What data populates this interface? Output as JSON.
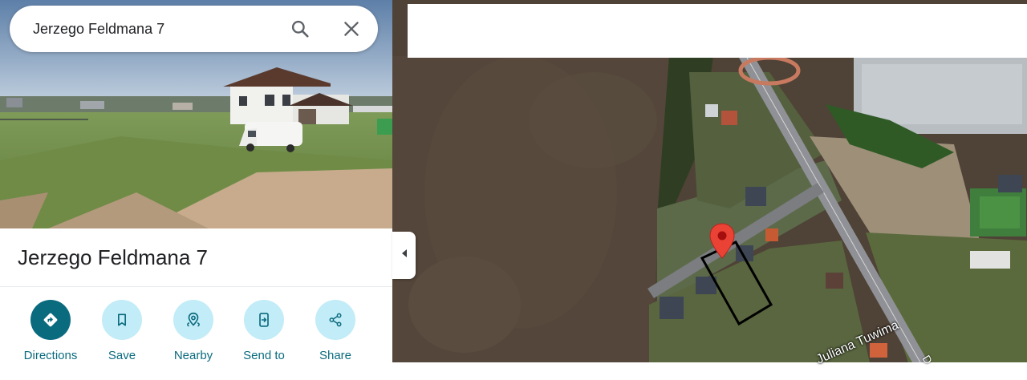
{
  "search": {
    "query": "Jerzego Feldmana 7",
    "search_icon": "search-icon",
    "clear_icon": "close-icon"
  },
  "place": {
    "title": "Jerzego Feldmana 7"
  },
  "actions": [
    {
      "label": "Directions",
      "icon": "directions-icon"
    },
    {
      "label": "Save",
      "icon": "bookmark-icon"
    },
    {
      "label": "Nearby",
      "icon": "nearby-pin-icon"
    },
    {
      "label": "Send to",
      "icon": "send-to-phone-icon"
    },
    {
      "label": "Share",
      "icon": "share-icon"
    }
  ],
  "map": {
    "view": "satellite",
    "street_labels": [
      "Juliana Tuwima",
      "D"
    ],
    "marker_icon": "map-pin-icon",
    "collapse_icon": "chevron-left-icon"
  },
  "colors": {
    "accent": "#0b6b7e",
    "action_circle": "#c2ecf7",
    "marker": "#ea4335"
  }
}
